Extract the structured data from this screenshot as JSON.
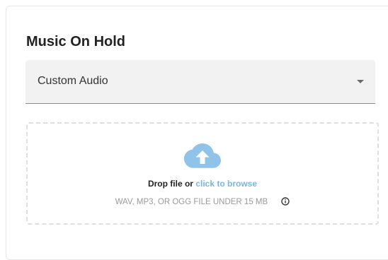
{
  "section": {
    "title": "Music On Hold"
  },
  "select": {
    "value": "Custom Audio",
    "icon": "chevron-down-icon"
  },
  "upload": {
    "icon": "cloud-upload-icon",
    "drop_text": "Drop file or",
    "browse_link": "click to browse",
    "hint": "WAV, MP3, OR OGG FILE UNDER 15 MB",
    "info_icon": "info-icon"
  },
  "colors": {
    "accent": "#7ab6e3",
    "field_bg": "#f2f2f2",
    "dashed_border": "#dedede",
    "text_muted": "#9a9a9a"
  }
}
